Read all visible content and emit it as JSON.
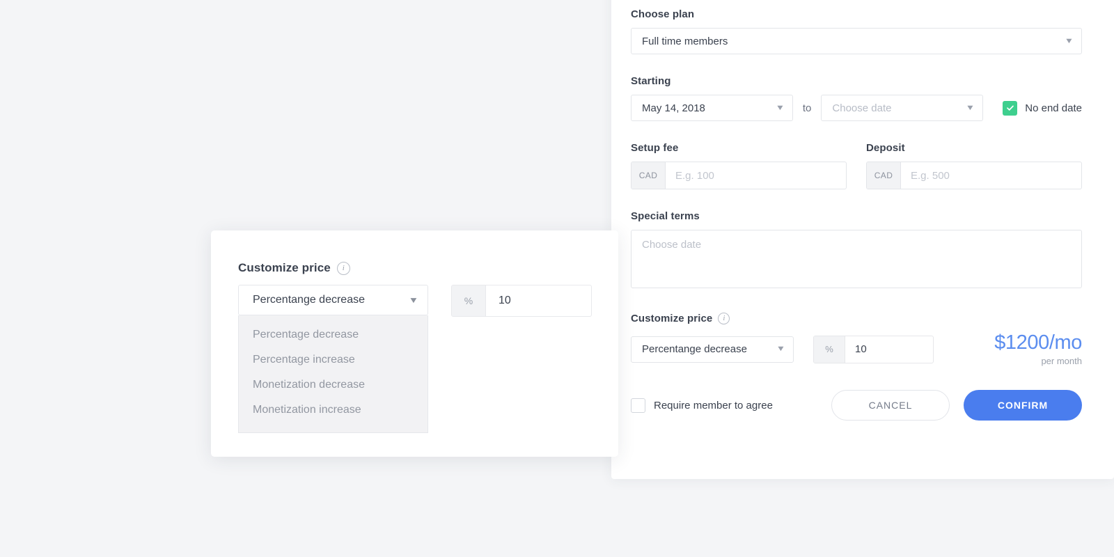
{
  "theme": {
    "page_background": "#f4f5f7",
    "accent_blue": "#4a7dee",
    "price_blue": "#5b8def",
    "check_green": "#3ecf8e",
    "text_dark": "#3b424f",
    "text_muted": "#9aa0ab"
  },
  "panel": {
    "plan": {
      "label": "Choose plan",
      "selected": "Full time members",
      "caret": "▼"
    },
    "starting": {
      "label": "Starting",
      "start_date": "May 14, 2018",
      "to_word": "to",
      "end_date_placeholder": "Choose date",
      "caret": "▼",
      "no_end_date_label": "No end date",
      "no_end_date_checked": true,
      "checkmark": "✓"
    },
    "setup_fee": {
      "label": "Setup fee",
      "currency": "CAD",
      "value": "",
      "placeholder": "E.g. 100"
    },
    "deposit": {
      "label": "Deposit",
      "currency": "CAD",
      "value": "",
      "placeholder": "E.g. 500"
    },
    "special_terms": {
      "label": "Special terms",
      "value": "",
      "placeholder": "Choose date"
    },
    "customize_price": {
      "label": "Customize price",
      "info_glyph": "i",
      "type_selected": "Percentange decrease",
      "caret": "▼",
      "pct_symbol": "%",
      "pct_value": "10",
      "price_amount": "$1200/mo",
      "price_sub": "per month"
    },
    "footer": {
      "agree_label": "Require member to agree",
      "agree_checked": false,
      "cancel_label": "CANCEL",
      "confirm_label": "CONFIRM"
    }
  },
  "float_card": {
    "title": "Customize price",
    "info_glyph": "i",
    "selected": "Percentange decrease",
    "caret": "▼",
    "options": [
      "Percentage decrease",
      "Percentage increase",
      "Monetization decrease",
      "Monetization increase"
    ],
    "pct_symbol": "%",
    "pct_value": "10"
  }
}
